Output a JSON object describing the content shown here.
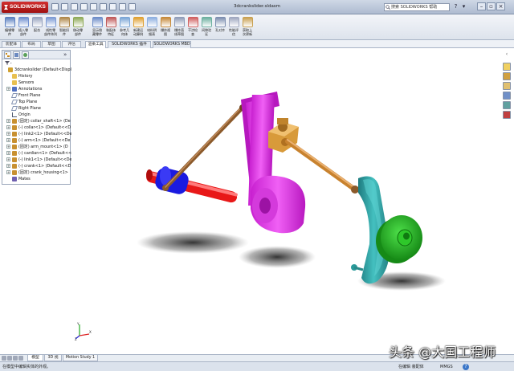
{
  "app": {
    "brand": "SOLIDWORKS",
    "document_title": "3dcrankslider.sldasm",
    "search_placeholder": "搜索 SOLIDWORKS 帮助"
  },
  "command_manager": {
    "buttons": [
      {
        "label": "编辑零\n件",
        "icon": "edit-component-icon",
        "color": "#5a7fc0"
      },
      {
        "label": "插入零\n部件",
        "icon": "insert-component-icon",
        "color": "#6e8fd0"
      },
      {
        "label": "配合",
        "icon": "mate-icon",
        "color": "#9aa6c0"
      },
      {
        "label": "线性零\n部件阵列",
        "icon": "pattern-icon",
        "color": "#7d9bd4"
      },
      {
        "label": "智能扣\n件",
        "icon": "smart-fastener-icon",
        "color": "#b0884a"
      },
      {
        "label": "移动零\n部件",
        "icon": "move-component-icon",
        "color": "#8faa58"
      },
      {
        "label": "显示隐\n藏零件",
        "icon": "show-hidden-icon",
        "color": "#6d8dc8"
      },
      {
        "label": "装配体\n特征",
        "icon": "assembly-feature-icon",
        "color": "#c05a5a"
      },
      {
        "label": "参考几\n何体",
        "icon": "reference-geometry-icon",
        "color": "#7ba6d6"
      },
      {
        "label": "新建运\n动算例",
        "icon": "motion-study-icon",
        "color": "#e0a030"
      },
      {
        "label": "材料明\n细表",
        "icon": "bom-icon",
        "color": "#8fb0e0"
      },
      {
        "label": "爆炸视\n图",
        "icon": "exploded-view-icon",
        "color": "#c68a3a"
      },
      {
        "label": "爆炸直\n线草图",
        "icon": "explode-line-icon",
        "color": "#909cb8"
      },
      {
        "label": "干涉检\n查",
        "icon": "interference-icon",
        "color": "#d06060"
      },
      {
        "label": "间隙验\n证",
        "icon": "clearance-icon",
        "color": "#6db0a0"
      },
      {
        "label": "孔对齐",
        "icon": "hole-align-icon",
        "color": "#7d8fb0"
      },
      {
        "label": "性能评\n估",
        "icon": "performance-icon",
        "color": "#a0a8c0"
      },
      {
        "label": "获取上\n次更新",
        "icon": "update-icon",
        "color": "#c8a050"
      }
    ]
  },
  "left_tabs": [
    "装配体",
    "布局",
    "草图",
    "评估"
  ],
  "cm_tabs": [
    "渲染工具",
    "SOLIDWORKS 插件",
    "SOLIDWORKS MBD"
  ],
  "feature_tree": {
    "items": [
      {
        "label": "3dcrankslider  (Default<Display St",
        "icon": "assembly-icon",
        "level": 0,
        "expander": ""
      },
      {
        "label": "History",
        "icon": "folder-icon",
        "level": 1,
        "expander": ""
      },
      {
        "label": "Sensors",
        "icon": "folder-icon",
        "level": 1,
        "expander": ""
      },
      {
        "label": "Annotations",
        "icon": "annotation-icon",
        "level": 1,
        "expander": "+"
      },
      {
        "label": "Front Plane",
        "icon": "plane-icon",
        "level": 1,
        "expander": ""
      },
      {
        "label": "Top Plane",
        "icon": "plane-icon",
        "level": 1,
        "expander": ""
      },
      {
        "label": "Right Plane",
        "icon": "plane-icon",
        "level": 1,
        "expander": ""
      },
      {
        "label": "Origin",
        "icon": "origin-icon",
        "level": 1,
        "expander": ""
      },
      {
        "label": "(固定) collar_shaft<1> (De",
        "icon": "part-icon",
        "level": 1,
        "expander": "+"
      },
      {
        "label": "(-) collar<1> (Default<<D",
        "icon": "part-icon",
        "level": 1,
        "expander": "+"
      },
      {
        "label": "(-) link2<1> (Default<<De",
        "icon": "part-icon",
        "level": 1,
        "expander": "+"
      },
      {
        "label": "(-) arm<1> (Default<<De",
        "icon": "part-icon",
        "level": 1,
        "expander": "+"
      },
      {
        "label": "(固定) arm_mount<1> (D",
        "icon": "part-icon",
        "level": 1,
        "expander": "+"
      },
      {
        "label": "(-) cardian<1> (Default<<",
        "icon": "part-icon",
        "level": 1,
        "expander": "+"
      },
      {
        "label": "(-) link1<1> (Default<<De",
        "icon": "part-icon",
        "level": 1,
        "expander": "+"
      },
      {
        "label": "(-) crank<1> (Default<<D",
        "icon": "part-icon",
        "level": 1,
        "expander": "+"
      },
      {
        "label": "(固定) crank_housing<1>",
        "icon": "part-icon",
        "level": 1,
        "expander": "+"
      },
      {
        "label": "Mates",
        "icon": "mates-icon",
        "level": 1,
        "expander": ""
      }
    ]
  },
  "bottom_tabs": [
    "模型",
    "3D 视图",
    "Motion Study 1"
  ],
  "status_bar": {
    "message": "在模型中编辑实体的外观。",
    "state": "在编辑 装配体",
    "units": "MMGS"
  },
  "watermark": "头条 @大国工程师",
  "colors": {
    "collar": "#1a1ae0",
    "collar_shaft": "#e81818",
    "arm": "#e030e8",
    "link": "#8b5a2b",
    "cardan": "#d89a3a",
    "crank": "#2e9c9c",
    "crank_housing": "#22b020"
  }
}
